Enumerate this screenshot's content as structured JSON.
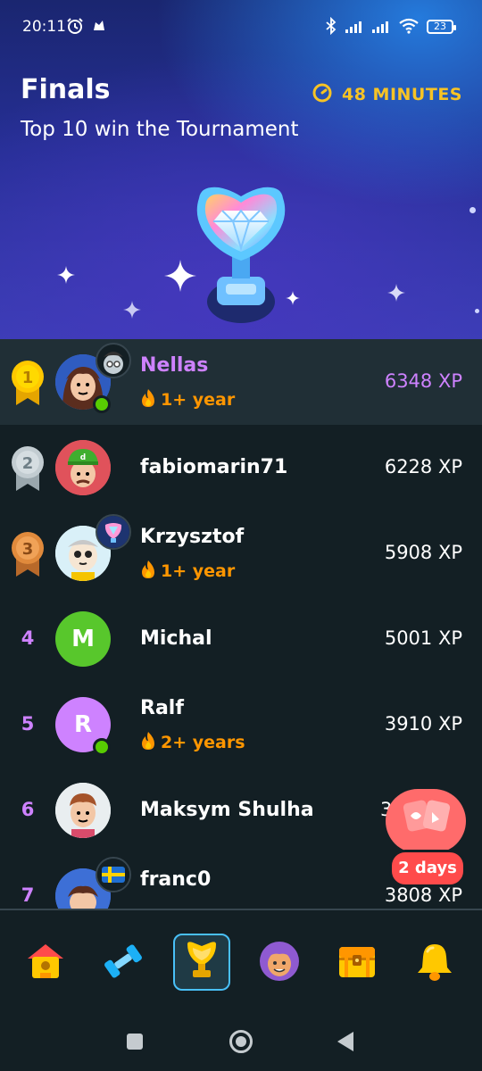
{
  "status_bar": {
    "time": "20:11",
    "battery": "23"
  },
  "header": {
    "title": "Finals",
    "subtitle": "Top 10 win the Tournament",
    "timer": "48 MINUTES"
  },
  "leaderboard": [
    {
      "rank": "1",
      "name": "Nellas",
      "streak": "1+ year",
      "xp": "6348 XP"
    },
    {
      "rank": "2",
      "name": "fabiomarin71",
      "xp": "6228 XP"
    },
    {
      "rank": "3",
      "name": "Krzysztof",
      "streak": "1+ year",
      "xp": "5908 XP"
    },
    {
      "rank": "4",
      "name": "Michal",
      "initial": "M",
      "xp": "5001 XP"
    },
    {
      "rank": "5",
      "name": "Ralf",
      "initial": "R",
      "streak": "2+ years",
      "xp": "3910 XP"
    },
    {
      "rank": "6",
      "name": "Maksym Shulha",
      "xp": "3"
    },
    {
      "rank": "7",
      "name": "franc0",
      "xp": "3808 XP"
    }
  ],
  "promo": {
    "label": "2 days"
  },
  "colors": {
    "accent": "#ce82ff",
    "timer": "#f7c325",
    "streak": "#ff9600",
    "active_tab": "#49c0f8"
  },
  "nav": [
    "home-icon",
    "practice-icon",
    "leaderboard-icon",
    "profile-icon",
    "shop-icon",
    "notifications-icon"
  ]
}
